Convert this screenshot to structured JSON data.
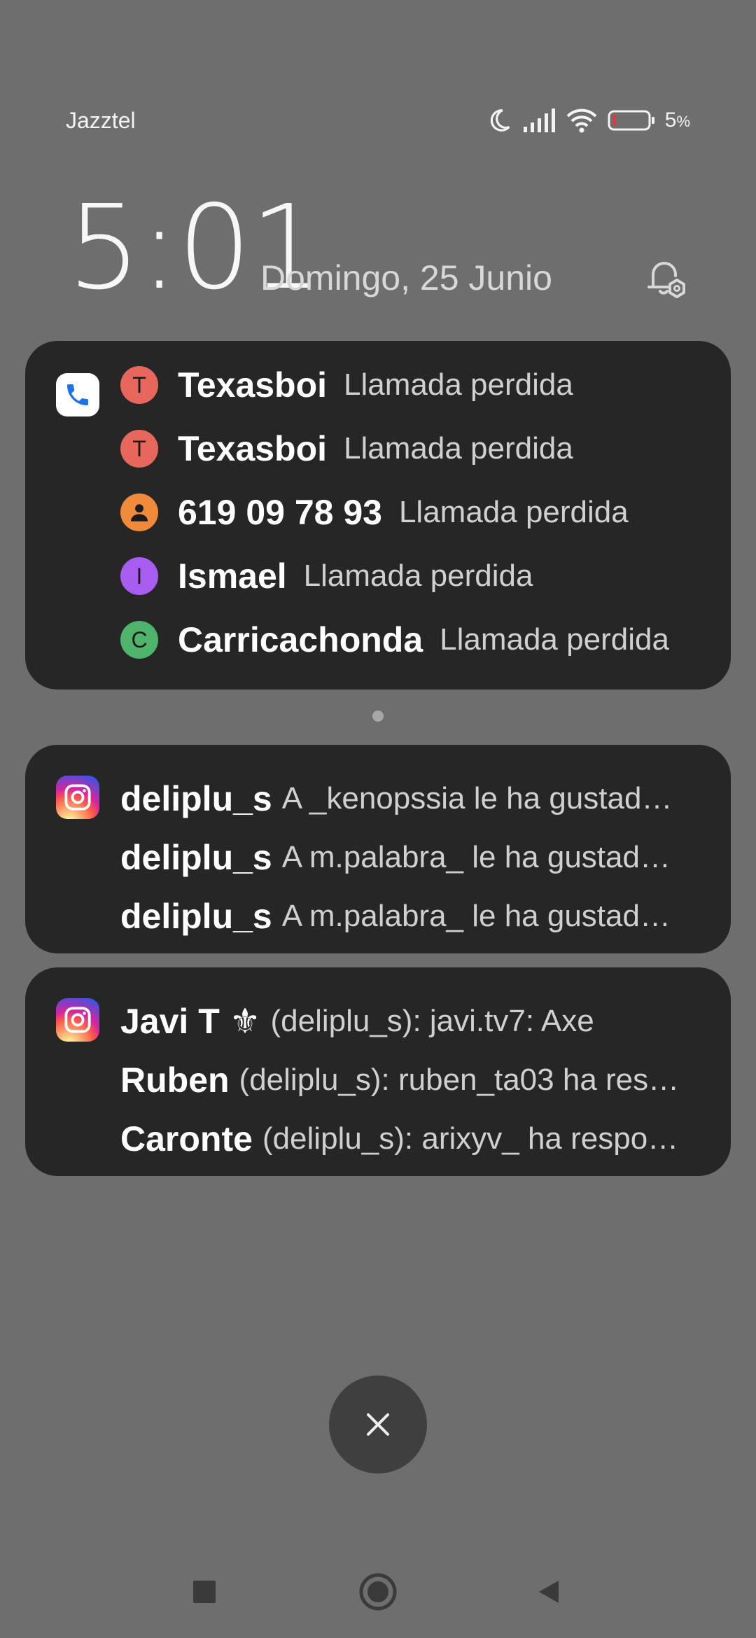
{
  "status_bar": {
    "carrier": "Jazztel",
    "battery_percent": "5",
    "battery_unit": "%",
    "icons": [
      "moon-icon",
      "signal-icon",
      "wifi-icon",
      "battery-icon"
    ]
  },
  "lockscreen": {
    "time": "5:01",
    "date": "Domingo, 25 Junio"
  },
  "call_notifications": {
    "app_icon": "phone-icon",
    "items": [
      {
        "initial": "T",
        "name": "Texasboi",
        "status": "Llamada perdida",
        "color": "#e8675c"
      },
      {
        "initial": "T",
        "name": "Texasboi",
        "status": "Llamada perdida",
        "color": "#e8675c"
      },
      {
        "initial": "",
        "name": "619 09 78 93",
        "status": "Llamada perdida",
        "color": "#ee8a3a"
      },
      {
        "initial": "I",
        "name": "Ismael",
        "status": "Llamada perdida",
        "color": "#a95cf0"
      },
      {
        "initial": "C",
        "name": "Carricachonda",
        "status": "Llamada perdida",
        "color": "#4eb46b"
      }
    ]
  },
  "instagram_group_1": {
    "app_icon": "instagram-icon",
    "items": [
      {
        "name": "deliplu_s",
        "text": "A _kenopssia le ha gustad…"
      },
      {
        "name": "deliplu_s",
        "text": "A m.palabra_ le ha gustad…"
      },
      {
        "name": "deliplu_s",
        "text": "A m.palabra_ le ha gustad…"
      }
    ]
  },
  "instagram_group_2": {
    "app_icon": "instagram-icon",
    "items": [
      {
        "name": "Javi T ⚜",
        "text": "(deliplu_s): javi.tv7: Axe"
      },
      {
        "name": "Ruben",
        "text": "(deliplu_s): ruben_ta03 ha res…"
      },
      {
        "name": "Caronte",
        "text": "(deliplu_s): arixyv_ ha respo…"
      }
    ]
  },
  "colors": {
    "background": "#6e6e6e",
    "card": "#262626",
    "battery_low": "#e53935"
  }
}
